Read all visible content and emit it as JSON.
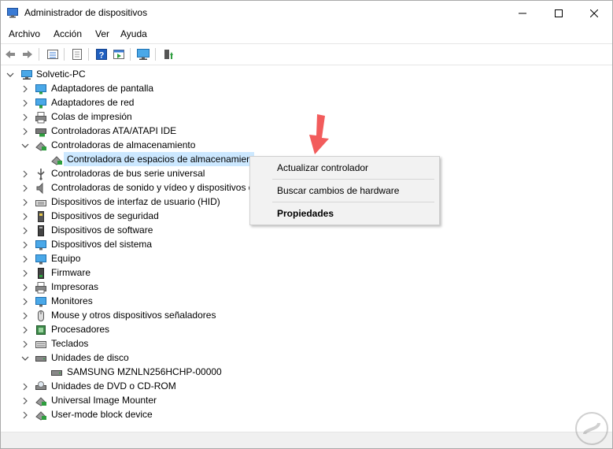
{
  "window": {
    "title": "Administrador de dispositivos"
  },
  "menu": [
    "Archivo",
    "Acción",
    "Ver",
    "Ayuda"
  ],
  "tree": {
    "root": "Solvetic-PC",
    "items": [
      "Adaptadores de pantalla",
      "Adaptadores de red",
      "Colas de impresión",
      "Controladoras ATA/ATAPI IDE",
      "Controladoras de almacenamiento",
      "Controladora de espacios de almacenamient",
      "Controladoras de bus serie universal",
      "Controladoras de sonido y vídeo y dispositivos d",
      "Dispositivos de interfaz de usuario (HID)",
      "Dispositivos de seguridad",
      "Dispositivos de software",
      "Dispositivos del sistema",
      "Equipo",
      "Firmware",
      "Impresoras",
      "Monitores",
      "Mouse y otros dispositivos señaladores",
      "Procesadores",
      "Teclados",
      "Unidades de disco",
      "SAMSUNG MZNLN256HCHP-00000",
      "Unidades de DVD o CD-ROM",
      "Universal Image Mounter",
      "User-mode block device"
    ]
  },
  "context_menu": {
    "update_driver": "Actualizar controlador",
    "scan_hardware": "Buscar cambios de hardware",
    "properties": "Propiedades"
  },
  "colors": {
    "selection": "#cce8ff",
    "arrow": "#f25c5c",
    "accent": "#1f6fc5"
  }
}
